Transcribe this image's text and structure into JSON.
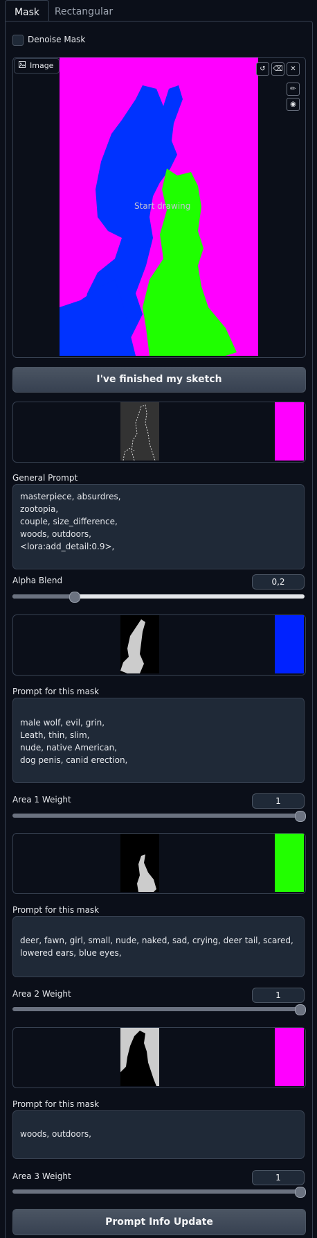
{
  "tabs": [
    {
      "label": "Mask",
      "active": true
    },
    {
      "label": "Rectangular",
      "active": false
    }
  ],
  "denoise_label": "Denoise Mask",
  "image_editor": {
    "label": "Image",
    "placeholder": "Start drawing",
    "tools": [
      "undo-icon",
      "eraser-icon",
      "close-icon",
      "brush-icon",
      "palette-icon"
    ],
    "sketch_colors": {
      "background": "#ff00ff",
      "region_a": "#0033ff",
      "region_b": "#1fff00"
    }
  },
  "finish_button": "I've finished my sketch",
  "general_prompt": {
    "label": "General Prompt",
    "value": "masterpiece, absurdres,\nzootopia,\ncouple, size_difference,\nwoods, outdoors,\n<lora:add_detail:0.9>,"
  },
  "alpha_blend": {
    "label": "Alpha Blend",
    "value": "0,2",
    "fraction": 0.2
  },
  "masks": [
    {
      "swatch": "#ff00ff",
      "prompt_label": "Prompt for this mask",
      "prompt": "\nmale wolf, evil, grin,\nLeath, thin, slim,\nnude, native American,\ndog penis, canid erection,",
      "weight_label": "Area 1 Weight",
      "weight": "1",
      "weight_fraction": 1.0
    },
    {
      "swatch": "#0022ff",
      "prompt_label": "Prompt for this mask",
      "prompt": "deer, fawn, girl, small, nude, naked, sad, crying, deer tail, scared, lowered ears, blue eyes,",
      "weight_label": "Area 2 Weight",
      "weight": "1",
      "weight_fraction": 1.0
    },
    {
      "swatch": "#22ff00",
      "prompt_label": "Prompt for this mask",
      "prompt": "woods, outdoors,",
      "weight_label": "Area 3 Weight",
      "weight": "1",
      "weight_fraction": 1.0
    },
    {
      "swatch": "#ff00ff"
    }
  ],
  "update_button": "Prompt Info Update"
}
